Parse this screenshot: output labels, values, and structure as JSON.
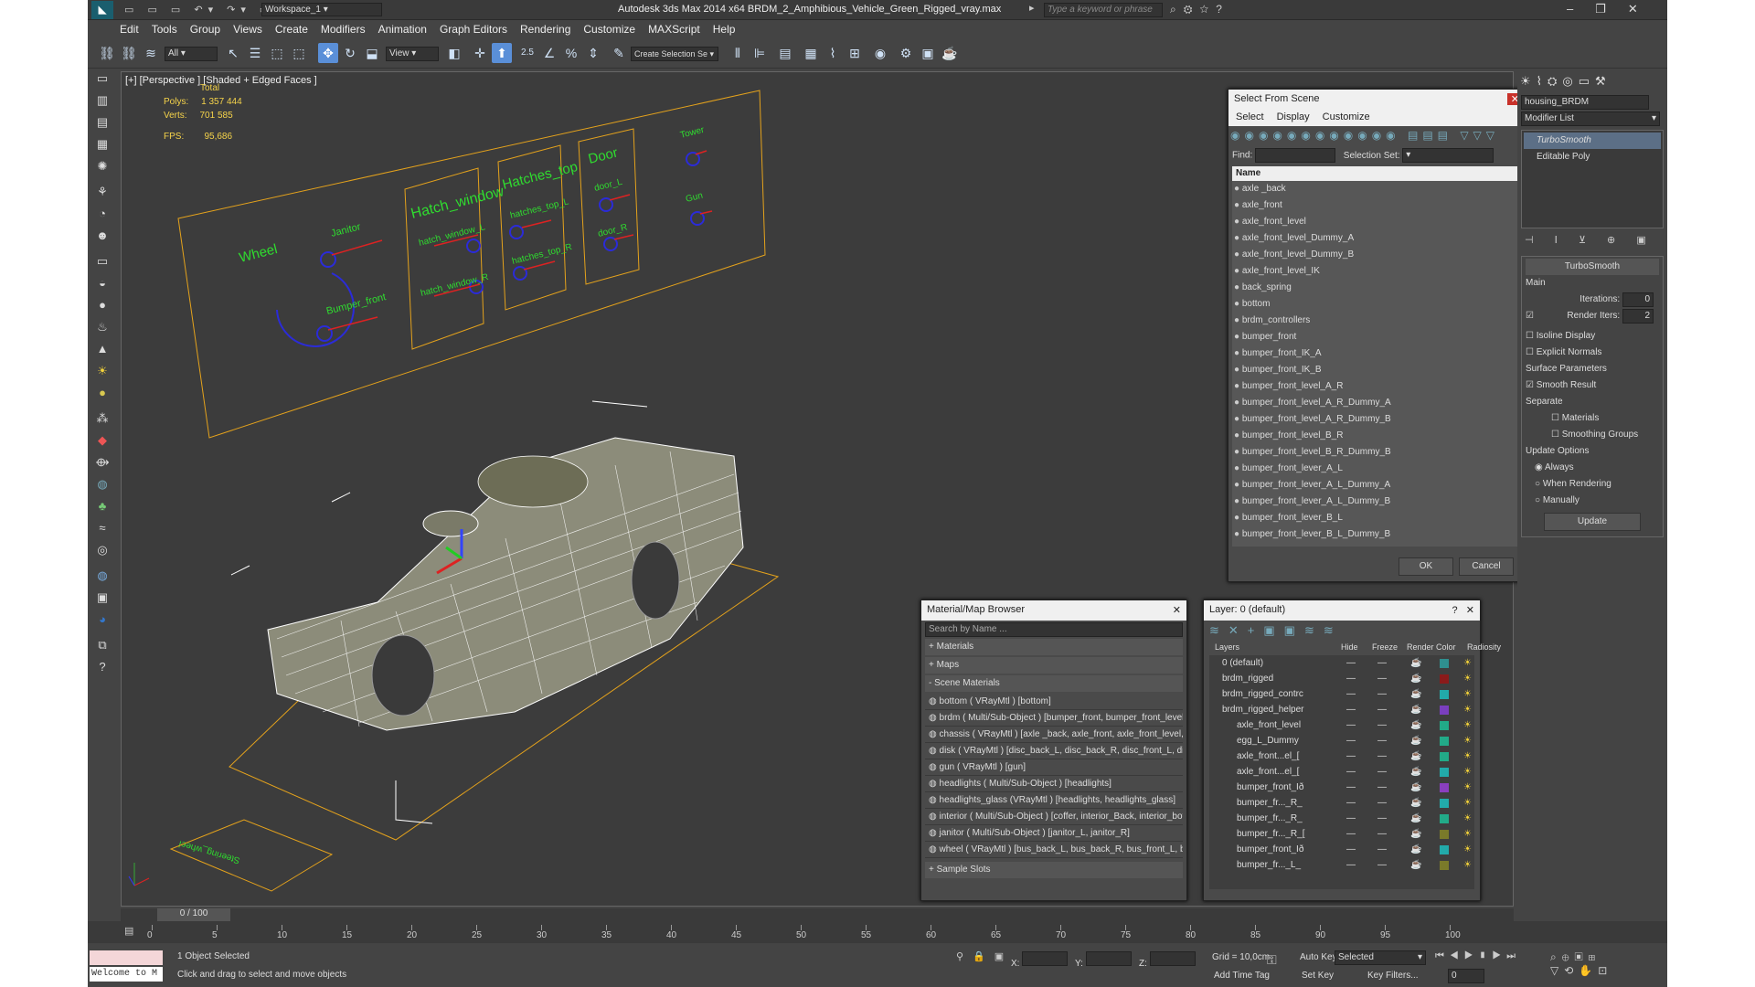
{
  "app": {
    "title": "Autodesk 3ds Max  2014 x64     BRDM_2_Amphibious_Vehicle_Green_Rigged_vray.max",
    "workspace": "Workspace_1",
    "search_placeholder": "Type a keyword or phrase",
    "quick_icons": [
      "new-icon",
      "open-icon",
      "save-icon",
      "undo-icon",
      "redo-icon",
      "project-icon"
    ]
  },
  "menus": [
    "Edit",
    "Tools",
    "Group",
    "Views",
    "Create",
    "Modifiers",
    "Animation",
    "Graph Editors",
    "Rendering",
    "Customize",
    "MAXScript",
    "Help"
  ],
  "toolbar": {
    "filter": "All",
    "coord": "View",
    "snap_label": "2.5",
    "selection_set": "Create Selection Se"
  },
  "viewport": {
    "label": "[+] [Perspective ] [Shaded + Edged Faces ]",
    "stats": {
      "total_label": "Total",
      "polys_label": "Polys:",
      "polys": "1 357 444",
      "verts_label": "Verts:",
      "verts": "701 585",
      "fps_label": "FPS:",
      "fps": "95,686"
    },
    "panel_labels": {
      "wheel": "Wheel",
      "janitor": "Janitor",
      "bumper": "Bumper_front",
      "hatch_window": "Hatch_window",
      "hatch_window_l": "hatch_window_L",
      "hatch_window_r": "hatch_window_R",
      "hatches_top": "Hatches_top",
      "hatches_top_l": "hatches_top_L",
      "hatches_top_r": "hatches_top_R",
      "door": "Door",
      "door_l": "door_L",
      "door_r": "door_R",
      "tower": "Tower",
      "gun": "Gun",
      "steering": "Steering_wheel"
    }
  },
  "select_from_scene": {
    "title": "Select From Scene",
    "menu": [
      "Select",
      "Display",
      "Customize"
    ],
    "find_label": "Find:",
    "selset_label": "Selection Set:",
    "col_name": "Name",
    "items": [
      "axle _back",
      "axle_front",
      "axle_front_level",
      "axle_front_level_Dummy_A",
      "axle_front_level_Dummy_B",
      "axle_front_level_IK",
      "back_spring",
      "bottom",
      "brdm_controllers",
      "bumper_front",
      "bumper_front_IK_A",
      "bumper_front_IK_B",
      "bumper_front_level_A_R",
      "bumper_front_level_A_R_Dummy_A",
      "bumper_front_level_A_R_Dummy_B",
      "bumper_front_level_B_R",
      "bumper_front_level_B_R_Dummy_B",
      "bumper_front_lever_A_L",
      "bumper_front_lever_A_L_Dummy_A",
      "bumper_front_lever_A_L_Dummy_B",
      "bumper_front_lever_B_L",
      "bumper_front_lever_B_L_Dummy_B"
    ],
    "ok": "OK",
    "cancel": "Cancel"
  },
  "material_browser": {
    "title": "Material/Map Browser",
    "search_placeholder": "Search by Name ...",
    "groups": [
      "+ Materials",
      "+ Maps",
      "- Scene Materials"
    ],
    "materials": [
      "bottom  ( VRayMtl ) [bottom]",
      "brdm  ( Multi/Sub-Object ) [bumper_front, bumper_front_level_...",
      "chassis  ( VRayMtl ) [axle _back, axle_front, axle_front_level, ba...",
      "disk  ( VRayMtl ) [disc_back_L, disc_back_R, disc_front_L, disc_...",
      "gun  ( VRayMtl ) [gun]",
      "headlights  ( Multi/Sub-Object ) [headlights]",
      "headlights_glass  (VRayMtl ) [headlights, headlights_glass]",
      "interior  ( Multi/Sub-Object ) [coffer, interior_Back, interior_bott...",
      "janitor  ( Multi/Sub-Object ) [janitor_L, janitor_R]",
      "wheel  ( VRayMtl ) [bus_back_L, bus_back_R, bus_front_L, bus..."
    ],
    "sample_slots": "+ Sample Slots"
  },
  "layers": {
    "title": "Layer: 0 (default)",
    "cols": [
      "Layers",
      "Hide",
      "Freeze",
      "Render",
      "Color",
      "Radiosity"
    ],
    "rows": [
      "0 (default)",
      "brdm_rigged",
      "brdm_rigged_contrc",
      "brdm_rigged_helper",
      "axle_front_level",
      "egg_L_Dummy",
      "axle_front...el_[",
      "axle_front...el_[",
      "bumper_front_Ið",
      "bumper_fr..._R_",
      "bumper_fr..._R_",
      "bumper_fr..._R_[",
      "bumper_front_Ið",
      "bumper_fr..._L_"
    ],
    "colors": [
      "#2f8f8f",
      "#8b1a1a",
      "#2aa",
      "#7a3fbf",
      "#2a8",
      "#2a8",
      "#2a8",
      "#2aa",
      "#8a3fbf",
      "#2aa",
      "#2a8",
      "#7a7a2a",
      "#2aa",
      "#7a7a2a"
    ]
  },
  "command_panel": {
    "object_name": "housing_BRDM",
    "modifier_list": "Modifier List",
    "stack": [
      "TurboSmooth",
      "Editable Poly"
    ],
    "rollout_title": "TurboSmooth",
    "main_label": "Main",
    "iterations_label": "Iterations:",
    "iterations": "0",
    "render_iters_label": "Render Iters:",
    "render_iters": "2",
    "isoline": "Isoline Display",
    "explicit": "Explicit Normals",
    "surface_params": "Surface Parameters",
    "smooth_result": "Smooth Result",
    "separate": "Separate",
    "materials": "Materials",
    "smoothing_groups": "Smoothing Groups",
    "update_options": "Update Options",
    "always": "Always",
    "when_rendering": "When Rendering",
    "manually": "Manually",
    "update_btn": "Update"
  },
  "timeline": {
    "frame": "0 / 100",
    "ticks": [
      "0",
      "5",
      "10",
      "15",
      "20",
      "25",
      "30",
      "35",
      "40",
      "45",
      "50",
      "55",
      "60",
      "65",
      "70",
      "75",
      "80",
      "85",
      "90",
      "95",
      "100"
    ]
  },
  "status": {
    "selected": "1 Object Selected",
    "prompt": "Click and drag to select and move objects",
    "welcome": "Welcome to M",
    "x_label": "X:",
    "y_label": "Y:",
    "z_label": "Z:",
    "grid": "Grid = 10,0cm",
    "add_time_tag": "Add Time Tag",
    "auto_key": "Auto Key",
    "set_key": "Set Key",
    "selected_dd": "Selected",
    "key_filters": "Key Filters...",
    "frame_val": "0"
  }
}
